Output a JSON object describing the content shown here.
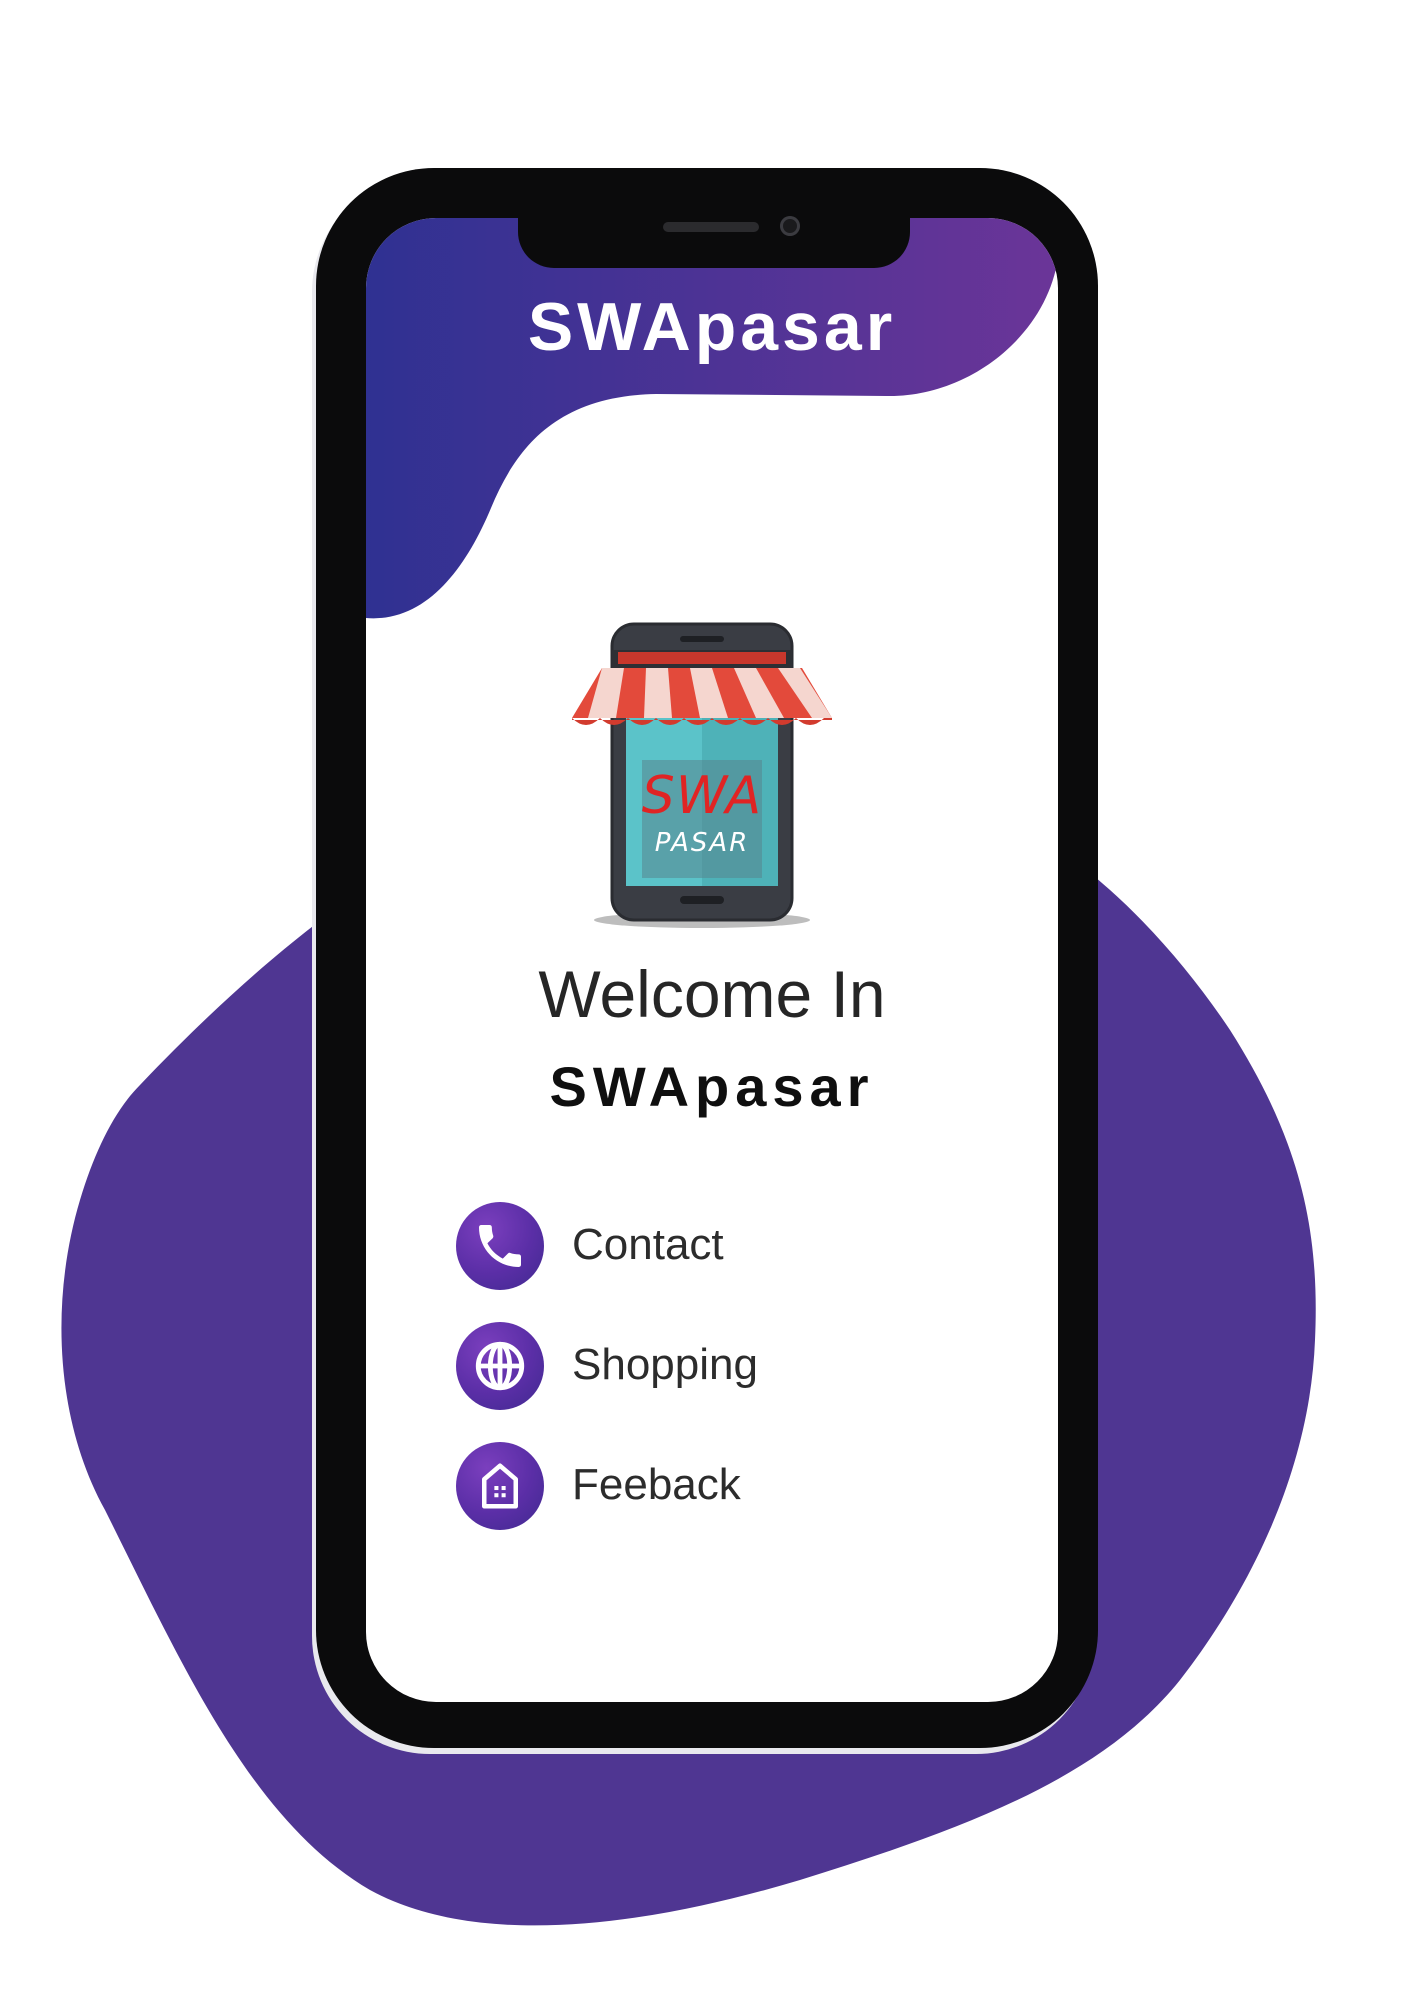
{
  "app": {
    "title": "SWApasar"
  },
  "logo": {
    "line1": "SWA",
    "line2": "PASAR"
  },
  "welcome": {
    "line1": "Welcome In",
    "line2": "SWApasar"
  },
  "menu": {
    "items": [
      {
        "label": "Contact",
        "icon": "phone-icon"
      },
      {
        "label": "Shopping",
        "icon": "globe-icon"
      },
      {
        "label": "Feeback",
        "icon": "building-icon"
      }
    ]
  },
  "colors": {
    "blob": "#4f3692",
    "header_gradient_start": "#2f3192",
    "header_gradient_end": "#6b3598",
    "phone_frame": "#0b0b0c",
    "awning_red": "#e34a3b"
  }
}
